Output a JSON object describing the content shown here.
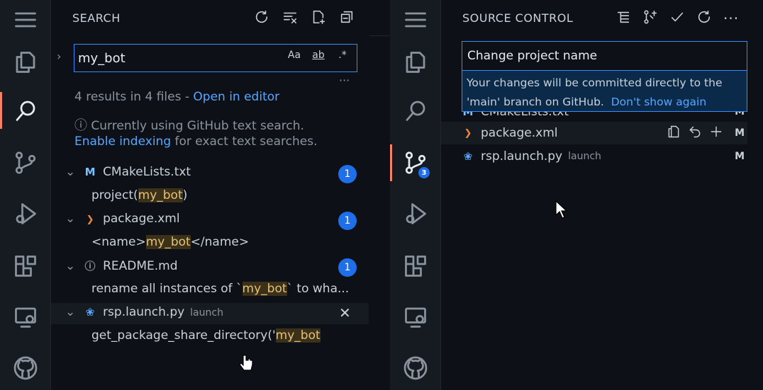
{
  "search_panel": {
    "title": "SEARCH",
    "query": "my_bot",
    "option_case": "Aa",
    "option_word": "ab",
    "option_regex": ".*",
    "more": "···",
    "results_summary": "4 results in 4 files - ",
    "open_in_editor": "Open in editor",
    "info_line1": "Currently using GitHub text search.",
    "enable_indexing": "Enable indexing",
    "info_line2_rest": " for exact text searches.",
    "results": [
      {
        "file": "CMakeLists.txt",
        "icon": "M",
        "count": "1",
        "match_pre": "project(",
        "match": "my_bot",
        "match_post": ")"
      },
      {
        "file": "package.xml",
        "icon": "rss-icon",
        "count": "1",
        "match_pre": "<name>",
        "match": "my_bot",
        "match_post": "</name>"
      },
      {
        "file": "README.md",
        "icon": "info-icon",
        "count": "1",
        "match_pre": "rename all instances of `",
        "match": "my_bot",
        "match_post": "` to wha..."
      },
      {
        "file": "rsp.launch.py",
        "icon": "python-icon",
        "tag": "launch",
        "match_pre": "get_package_share_directory('",
        "match": "my_bot",
        "match_post": ""
      }
    ]
  },
  "scm_panel": {
    "title": "SOURCE CONTROL",
    "commit_message": "Change project name",
    "tip_line1": "Your changes will be committed directly to the",
    "tip_line2": "'main' branch on GitHub.",
    "tip_link": "Don't show again",
    "files": [
      {
        "name": "CMakeLists.txt",
        "status": "M"
      },
      {
        "name": "package.xml",
        "status": "M"
      },
      {
        "name": "rsp.launch.py",
        "tag": "launch",
        "status": "M"
      }
    ],
    "badge": "3"
  },
  "colors": {
    "accent": "#1f6feb",
    "active_indicator": "#f78166",
    "link": "#58a6ff",
    "match_highlight": "#3b3118"
  }
}
